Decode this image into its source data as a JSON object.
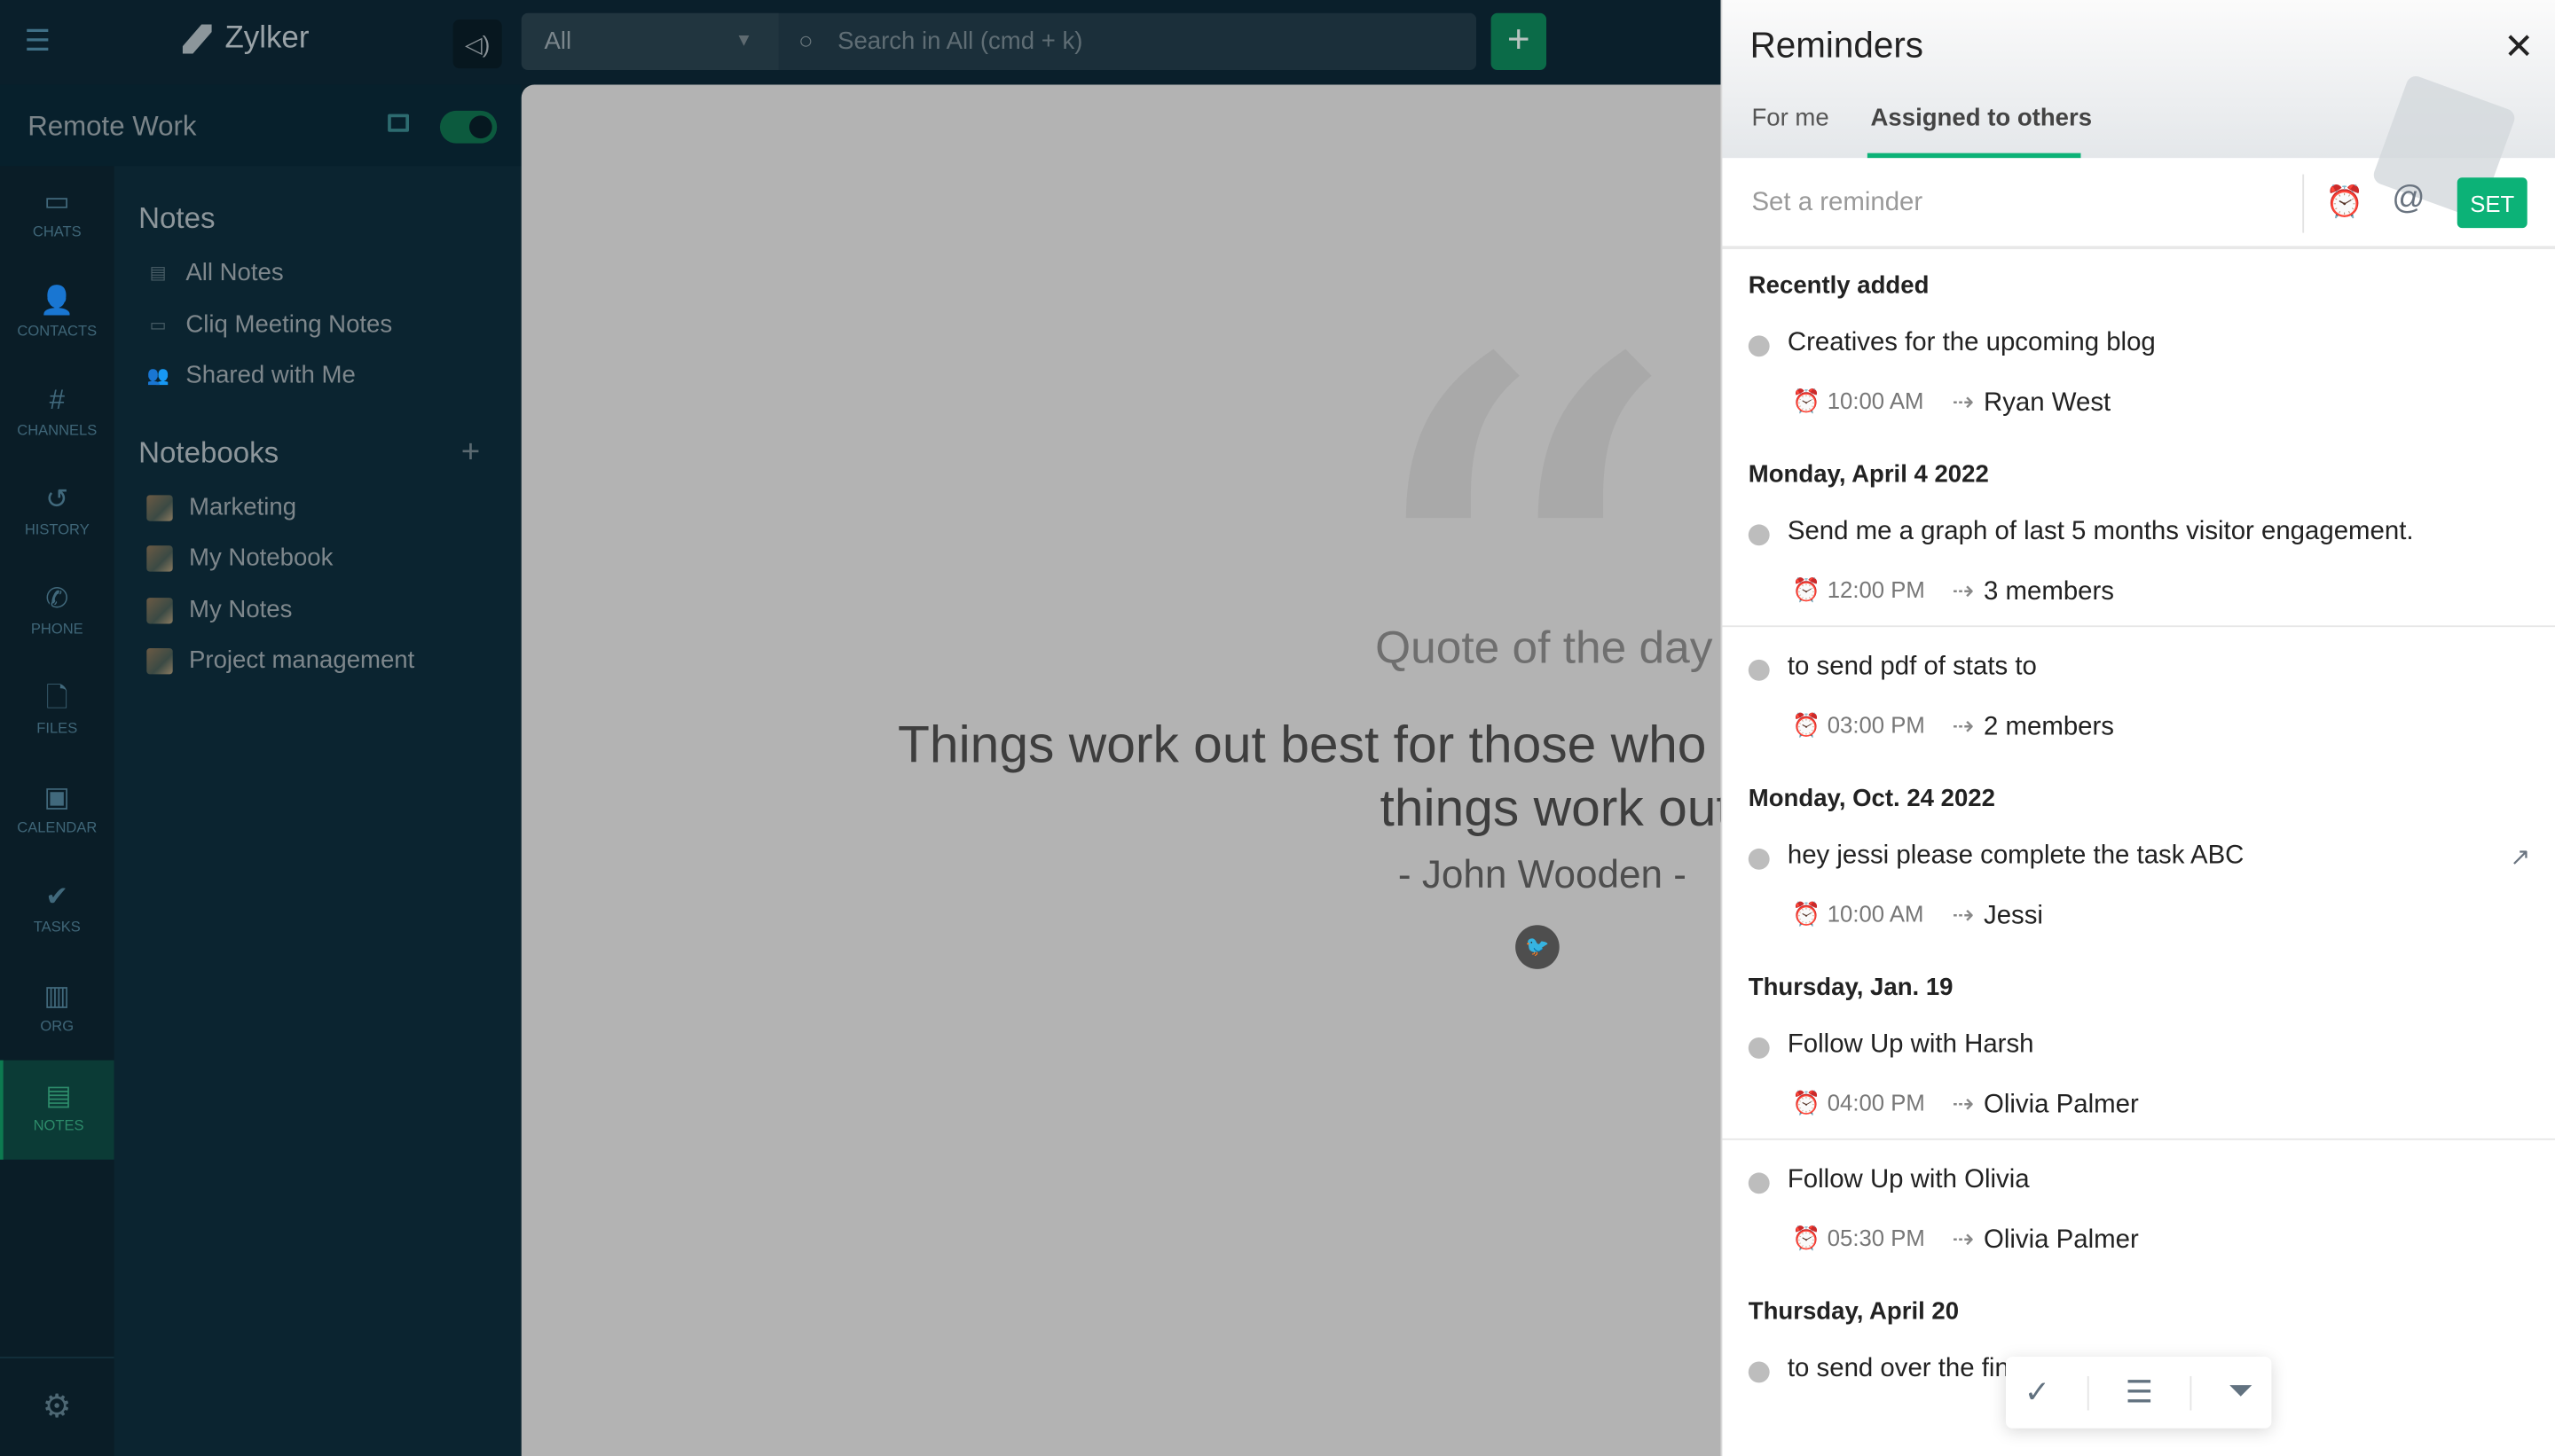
{
  "topbar": {
    "app_name": "Zylker",
    "scope": "All",
    "search_placeholder": "Search in All (cmd + k)"
  },
  "workspace": {
    "name": "Remote Work",
    "toggle_on": true
  },
  "rail": [
    {
      "label": "CHATS",
      "icon": "chat-icon"
    },
    {
      "label": "CONTACTS",
      "icon": "contacts-icon"
    },
    {
      "label": "CHANNELS",
      "icon": "hash-icon"
    },
    {
      "label": "HISTORY",
      "icon": "history-icon"
    },
    {
      "label": "PHONE",
      "icon": "phone-icon"
    },
    {
      "label": "FILES",
      "icon": "file-icon"
    },
    {
      "label": "CALENDAR",
      "icon": "calendar-icon"
    },
    {
      "label": "TASKS",
      "icon": "tasks-icon"
    },
    {
      "label": "ORG",
      "icon": "org-icon"
    },
    {
      "label": "NOTES",
      "icon": "notes-icon",
      "active": true
    }
  ],
  "sidebar": {
    "notes_title": "Notes",
    "notes": [
      {
        "label": "All Notes"
      },
      {
        "label": "Cliq Meeting Notes"
      },
      {
        "label": "Shared with Me"
      }
    ],
    "notebooks_title": "Notebooks",
    "notebooks": [
      {
        "label": "Marketing"
      },
      {
        "label": "My Notebook"
      },
      {
        "label": "My Notes"
      },
      {
        "label": "Project management"
      }
    ]
  },
  "main": {
    "quote_heading": "Quote of the day",
    "quote_line1": "Things work out best for those who m",
    "quote_line2": "things work out.",
    "author": "- John Wooden -"
  },
  "reminders": {
    "title": "Reminders",
    "tabs": [
      {
        "label": "For me"
      },
      {
        "label": "Assigned to others",
        "active": true
      }
    ],
    "input_placeholder": "Set a reminder",
    "set_label": "SET",
    "groups": [
      {
        "heading": "Recently added",
        "items": [
          {
            "title": "Creatives for the upcoming blog",
            "time": "10:00 AM",
            "assignee": "Ryan West",
            "overdue": false
          }
        ]
      },
      {
        "heading": "Monday, April 4 2022",
        "items": [
          {
            "title": "Send me a graph of last 5 months visitor engagement.",
            "time": "12:00 PM",
            "assignee": "3 members",
            "overdue": true
          },
          {
            "title": "to send pdf of stats to",
            "time": "03:00 PM",
            "assignee": "2 members",
            "overdue": true
          }
        ]
      },
      {
        "heading": "Monday, Oct. 24 2022",
        "items": [
          {
            "title": "hey jessi please complete the task ABC",
            "time": "10:00 AM",
            "assignee": "Jessi",
            "overdue": true,
            "external_link": true
          }
        ]
      },
      {
        "heading": "Thursday, Jan. 19",
        "items": [
          {
            "title": "Follow Up with Harsh",
            "time": "04:00 PM",
            "assignee": "Olivia Palmer",
            "overdue": true
          },
          {
            "title": "Follow Up with Olivia",
            "time": "05:30 PM",
            "assignee": "Olivia Palmer",
            "overdue": true
          }
        ]
      },
      {
        "heading": "Thursday, April 20",
        "items": [
          {
            "title": "to send over the final figures"
          }
        ]
      }
    ]
  },
  "colors": {
    "accent": "#0cb277",
    "overdue": "#e53935"
  }
}
